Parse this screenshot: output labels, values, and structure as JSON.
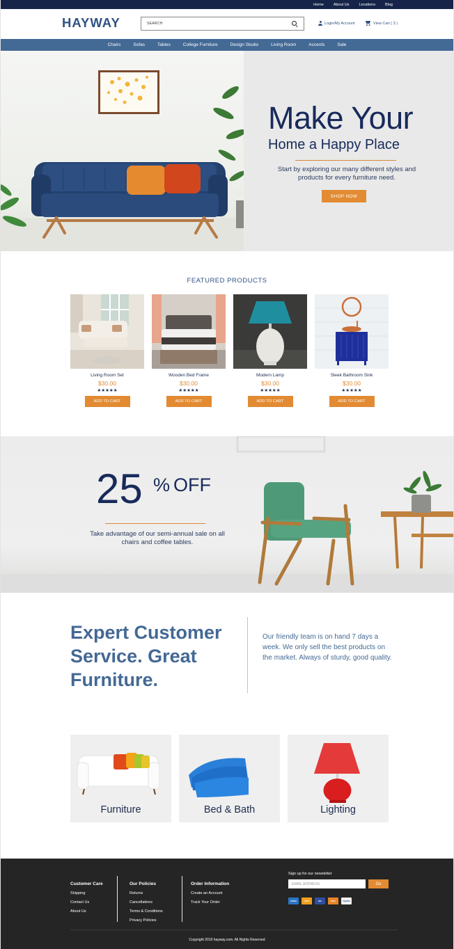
{
  "topbar": {
    "links": [
      "Home",
      "About Us",
      "Locations",
      "Blog"
    ]
  },
  "header": {
    "logo": "HAYWAY",
    "search_placeholder": "SEARCH",
    "account_label": "Login/My Account",
    "cart_label": "View Cart ( 3 )"
  },
  "nav": {
    "items": [
      "Chairs",
      "Sofas",
      "Tables",
      "College Furniture",
      "Design Studio",
      "Living Room",
      "Accents",
      "Sale"
    ]
  },
  "hero": {
    "title": "Make Your",
    "subtitle": "Home a Happy Place",
    "description": "Start by exploring our many different styles and products for every furniture need.",
    "button": "SHOP NOW"
  },
  "featured": {
    "title": "FEATURED PRODUCTS",
    "products": [
      {
        "name": "Living Room Set",
        "price": "$30.00",
        "rating": 5,
        "button": "ADD TO CART"
      },
      {
        "name": "Wooden Bed Frame",
        "price": "$30.00",
        "rating": 5,
        "button": "ADD TO CART"
      },
      {
        "name": "Modern Lamp",
        "price": "$30.00",
        "rating": 5,
        "button": "ADD TO CART"
      },
      {
        "name": "Sleek Bathroom Sink",
        "price": "$30.00",
        "rating": 5,
        "button": "ADD TO CART"
      }
    ]
  },
  "sale": {
    "number": "25",
    "percent": "%",
    "off": "OFF",
    "description": "Take advantage of our semi-annual sale on all chairs and coffee tables."
  },
  "expert": {
    "title": "Expert Customer Service. Great Furniture.",
    "description": "Our friendly team is on hand 7 days a week. We only sell the best products on the market. Always of sturdy, good quality."
  },
  "categories": [
    {
      "label": "Furniture"
    },
    {
      "label": "Bed & Bath"
    },
    {
      "label": "Lighting"
    }
  ],
  "footer": {
    "customer_care": {
      "title": "Customer Care",
      "links": [
        "Shipping",
        "Contact Us",
        "About Us"
      ]
    },
    "policies": {
      "title": "Our Policies",
      "links": [
        "Returns",
        "Cancellations",
        "Terms & Conditions",
        "Privacy Policies"
      ]
    },
    "order_info": {
      "title": "Order Information",
      "links": [
        "Create an Account",
        "Track Your Order"
      ]
    },
    "newsletter": {
      "label": "Sign up for our newsletter",
      "placeholder": "EMAIL ADDRESS",
      "button": "Go"
    },
    "payment_icons": [
      "amex-icon",
      "visa-icon",
      "mastercard-icon",
      "discover-icon",
      "paypal-icon"
    ],
    "copyright": "Copyright 2019 hayway.com. All Rights Reserved"
  },
  "colors": {
    "navy": "#16244a",
    "nav_blue": "#436995",
    "accent_orange": "#e28b32",
    "footer_bg": "#252525"
  }
}
